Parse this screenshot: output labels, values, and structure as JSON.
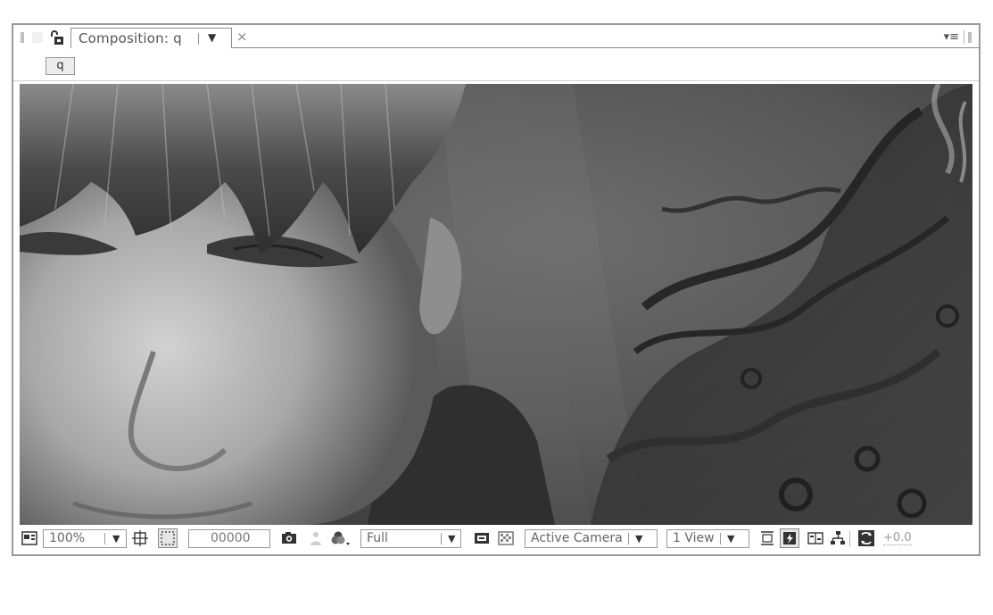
{
  "panel": {
    "tab_label": "Composition: q",
    "tab_dropdown_glyph": "▼",
    "tab_close_glyph": "×",
    "panel_menu_glyph": "▾≡"
  },
  "breadcrumb": {
    "label": "q"
  },
  "viewer": {
    "content": "composition preview image"
  },
  "toolbar": {
    "zoom_value": "100%",
    "timecode_value": "00000",
    "resolution_value": "Full",
    "camera_value": "Active Camera",
    "views_value": "1 View",
    "exposure_value": "+0.0",
    "dropdown_glyph": "▼"
  },
  "icons": {
    "lock": "lock-icon",
    "always_preview": "always-preview-icon",
    "grid": "grid-overlay-icon",
    "mask": "region-of-interest-icon",
    "snapshot": "camera-snapshot-icon",
    "show_snapshot": "show-snapshot-icon",
    "channel": "rgb-channel-icon",
    "fast_preview": "fast-preview-icon",
    "transparency": "transparency-grid-icon",
    "timeline": "timeline-icon",
    "flowchart": "flowchart-icon",
    "reset_exposure": "reset-exposure-icon"
  },
  "colors": {
    "panel_border": "#9a9a9a",
    "viewer_bg": "#555555"
  }
}
